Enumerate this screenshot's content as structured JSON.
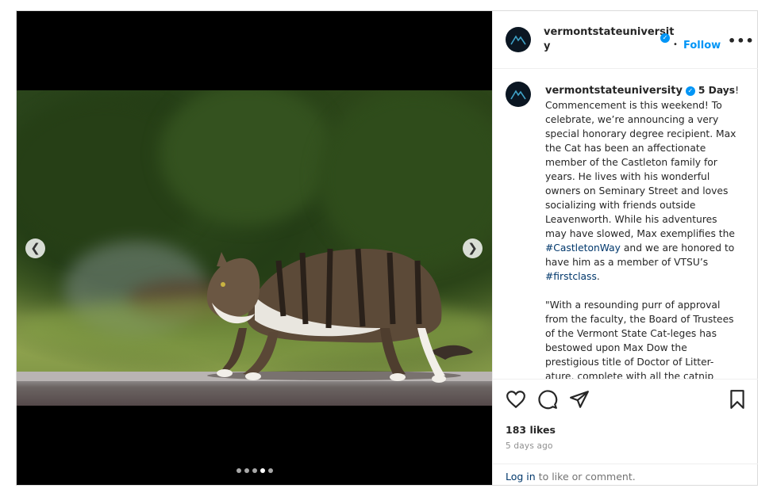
{
  "account": {
    "username_line1": "vermontstateuniversit",
    "username_line2": "y",
    "username": "vermontstateuniversity",
    "verified": true,
    "follow_label": "Follow",
    "separator": "•",
    "more_label": "•••"
  },
  "carousel": {
    "total": 5,
    "active_index": 3
  },
  "caption": {
    "highlight": "5 Days",
    "text_1": "!\nCommencement is this weekend! To celebrate, we’re announcing a very special honorary degree recipient. Max the Cat has been an affectionate member of the Castleton family for years. He lives with his wonderful owners on Seminary Street and loves socializing with friends outside Leavenworth. While his adventures may have slowed, Max exemplifies the ",
    "hashtag_1": "#CastletonWay",
    "text_2": " and we are honored to have him as a member of VTSU’s ",
    "hashtag_2": "#firstclass",
    "text_3": ".\n\n\"With a resounding purr of approval from the faculty, the Board of Trustees of the Vermont State Cat-leges has bestowed upon Max Dow the prestigious title of Doctor of Litter-ature, complete with all the catnip"
  },
  "engagement": {
    "likes": "183 likes",
    "time_ago": "5 days ago",
    "login_link": "Log in",
    "login_suffix": " to like or comment."
  },
  "icons": {
    "like": "heart-icon",
    "comment": "comment-icon",
    "share": "share-icon",
    "save": "bookmark-icon",
    "prev": "chevron-left-icon",
    "next": "chevron-right-icon"
  },
  "colors": {
    "link_blue": "#0095f6",
    "hashtag": "#00376b",
    "muted": "#8e8e8e"
  }
}
